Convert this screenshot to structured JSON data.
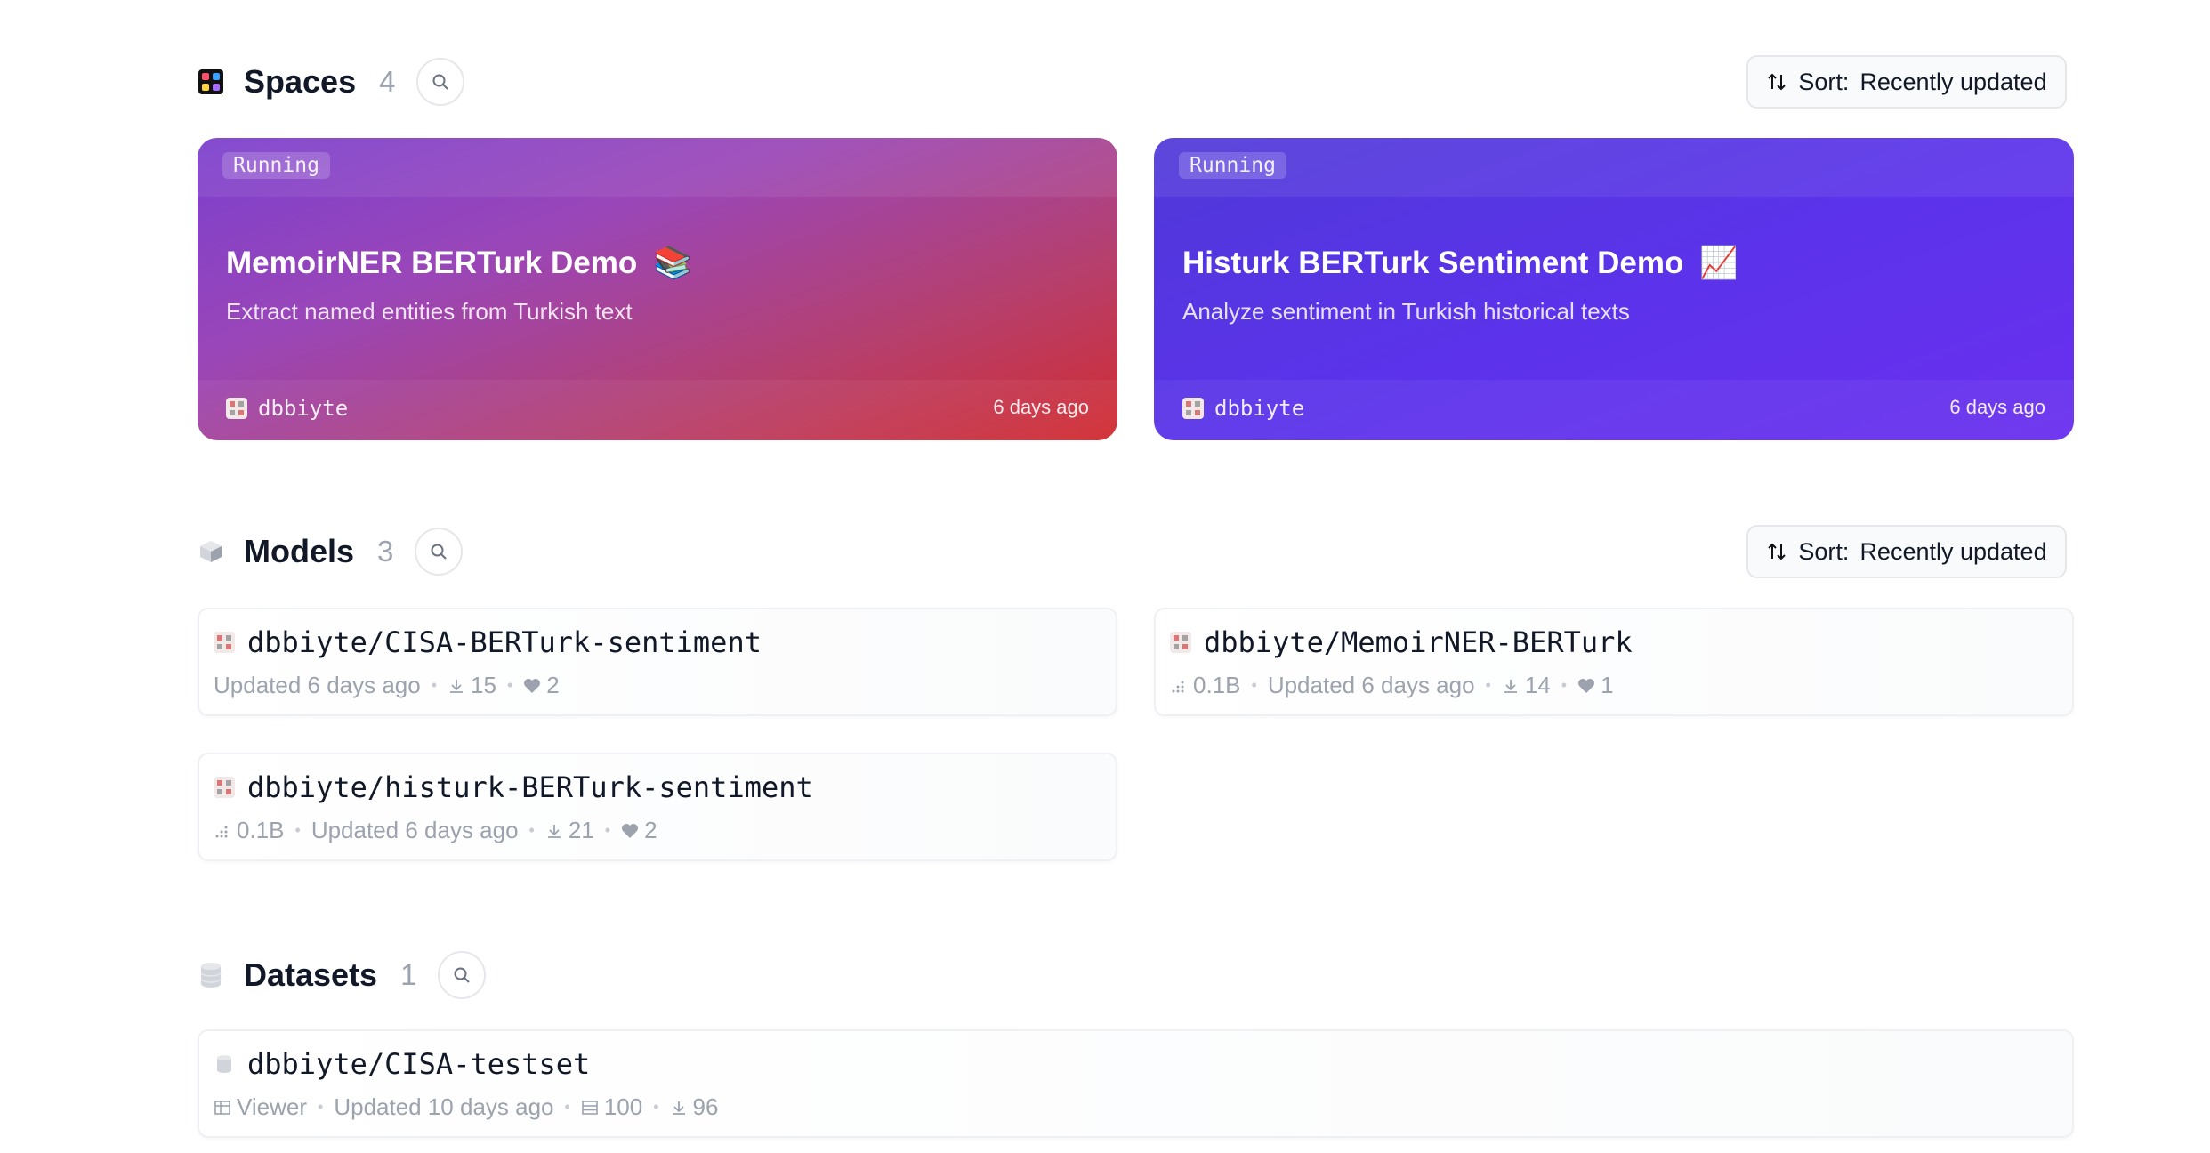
{
  "spaces": {
    "title": "Spaces",
    "count": "4",
    "sort_label": "Sort:",
    "sort_value": "Recently updated",
    "cards": [
      {
        "status": "Running",
        "title": "MemoirNER BERTurk Demo",
        "emoji": "📚",
        "description": "Extract named entities from Turkish text",
        "owner": "dbbiyte",
        "updated": "6 days ago"
      },
      {
        "status": "Running",
        "title": "Histurk BERTurk Sentiment Demo",
        "emoji": "📈",
        "description": "Analyze sentiment in Turkish historical texts",
        "owner": "dbbiyte",
        "updated": "6 days ago"
      }
    ]
  },
  "models": {
    "title": "Models",
    "count": "3",
    "sort_label": "Sort:",
    "sort_value": "Recently updated",
    "items": [
      {
        "name": "dbbiyte/CISA-BERTurk-sentiment",
        "updated": "Updated 6 days ago",
        "downloads": "15",
        "likes": "2"
      },
      {
        "name": "dbbiyte/MemoirNER-BERTurk",
        "params": "0.1B",
        "updated": "Updated 6 days ago",
        "downloads": "14",
        "likes": "1"
      },
      {
        "name": "dbbiyte/histurk-BERTurk-sentiment",
        "params": "0.1B",
        "updated": "Updated 6 days ago",
        "downloads": "21",
        "likes": "2"
      }
    ]
  },
  "datasets": {
    "title": "Datasets",
    "count": "1",
    "items": [
      {
        "name": "dbbiyte/CISA-testset",
        "viewer": "Viewer",
        "updated": "Updated 10 days ago",
        "rows": "100",
        "downloads": "96"
      }
    ]
  }
}
